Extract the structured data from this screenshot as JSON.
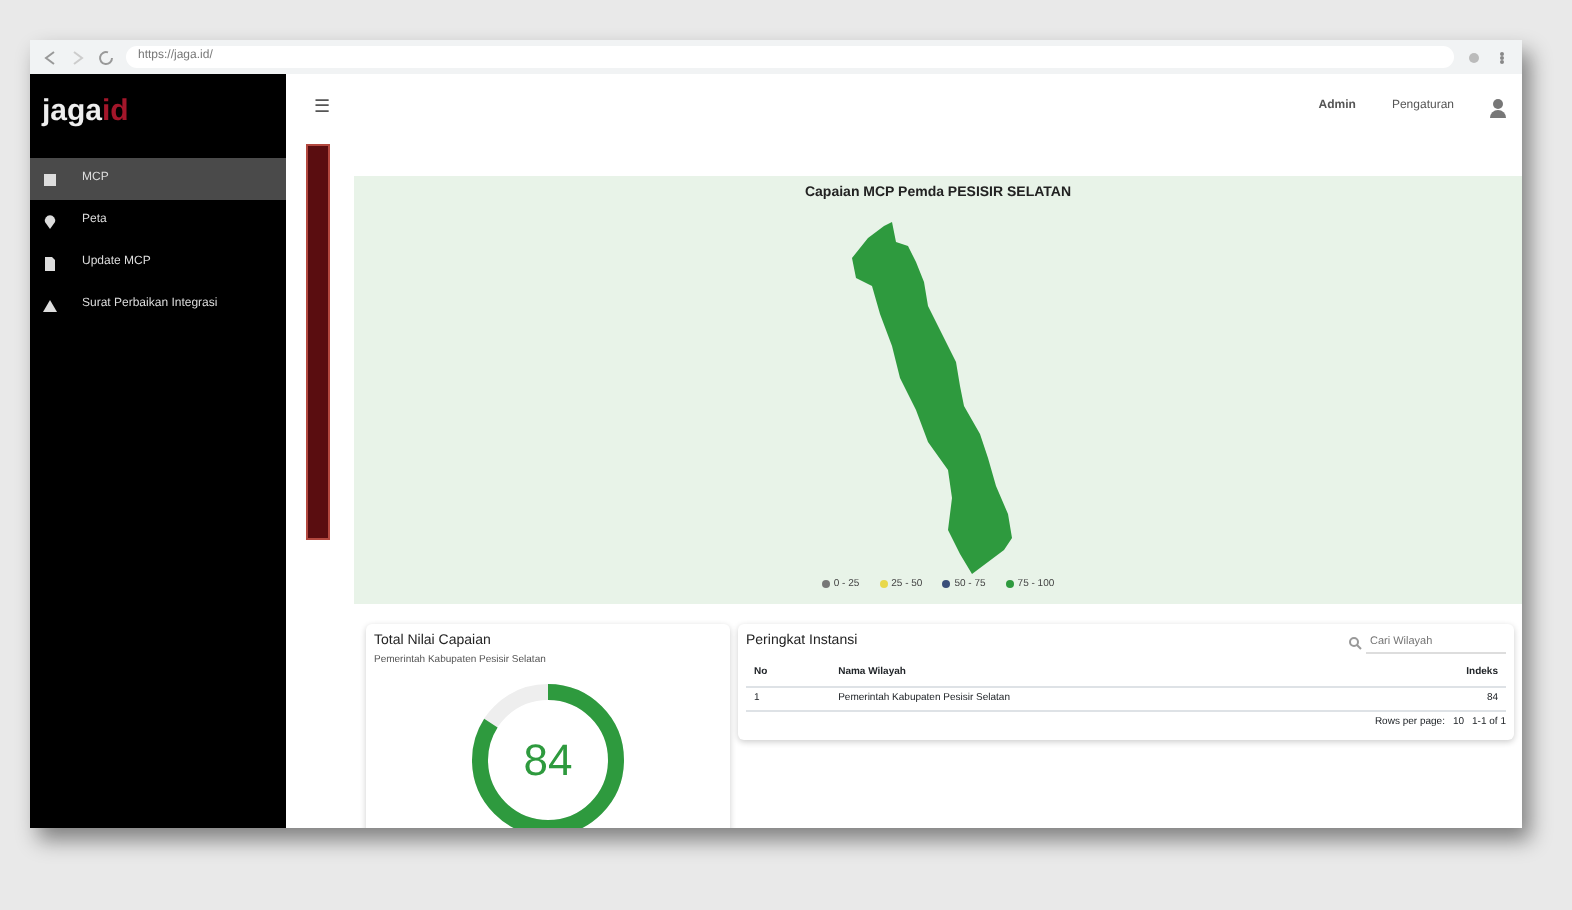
{
  "browser": {
    "url": "https://jaga.id/"
  },
  "sidebar": {
    "logo": "jaga",
    "logo_accent": "id",
    "items": [
      {
        "label": "MCP",
        "selected": true
      },
      {
        "label": "Peta",
        "selected": false
      },
      {
        "label": "Update MCP",
        "selected": false
      },
      {
        "label": "Surat Perbaikan Integrasi",
        "selected": false
      }
    ]
  },
  "topbar": {
    "menu": "☰",
    "links": [
      "Admin",
      "Pengaturan"
    ]
  },
  "map": {
    "title": "Capaian MCP Pemda PESISIR SELATAN",
    "legend": [
      {
        "label": "0 - 25",
        "color": "#777777"
      },
      {
        "label": "25 - 50",
        "color": "#e8d84a"
      },
      {
        "label": "50 - 75",
        "color": "#3a4f7a"
      },
      {
        "label": "75 - 100",
        "color": "#2e9a3e"
      }
    ]
  },
  "score": {
    "title": "Total Nilai Capaian",
    "subtitle": "Pemerintah Kabupaten Pesisir Selatan",
    "value": "84",
    "level": 0.84
  },
  "ranking": {
    "title": "Peringkat Instansi",
    "search": {
      "placeholder": "Cari Wilayah"
    },
    "columns": [
      "No",
      "Nama Wilayah",
      "Indeks"
    ],
    "rows": [
      [
        "1",
        "Pemerintah Kabupaten Pesisir Selatan",
        "84"
      ]
    ],
    "footer": {
      "rows_label": "Rows per page:",
      "rows_value": "10",
      "range": "1-1 of 1"
    }
  }
}
